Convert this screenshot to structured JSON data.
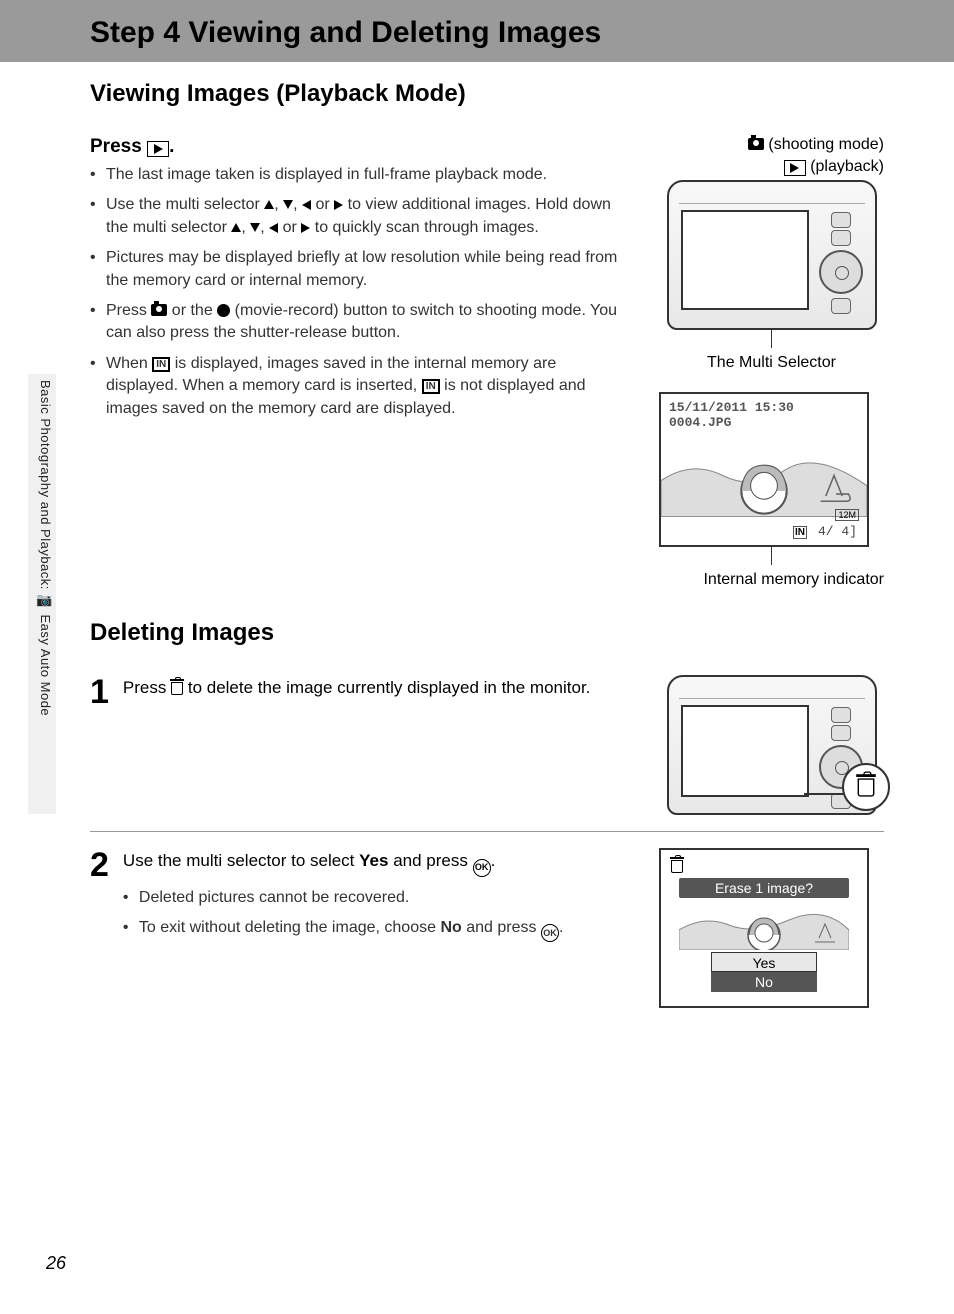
{
  "page_number": "26",
  "side_label": "Basic Photography and Playback: 📷 Easy Auto Mode",
  "title": "Step 4 Viewing and Deleting Images",
  "section_viewing": {
    "heading": "Viewing Images (Playback Mode)",
    "press_label": "Press",
    "bullets": {
      "b1": "The last image taken is displayed in full-frame playback mode.",
      "b2a": "Use the multi selector ",
      "b2b": " to view additional images. Hold down the multi selector ",
      "b2c": " to quickly scan through images.",
      "b3": "Pictures may be displayed briefly at low resolution while being read from the memory card or internal memory.",
      "b4a": "Press ",
      "b4b": " or the ",
      "b4c": " (movie-record) button to switch to shooting mode. You can also press the shutter-release button.",
      "b5a": "When ",
      "b5b": " is displayed, images saved in the internal memory are displayed. When a memory card is inserted, ",
      "b5c": " is not displayed and images saved on the memory card are displayed."
    },
    "labels": {
      "shooting": "(shooting mode)",
      "playback": "(playback)",
      "multi_selector": "The Multi Selector",
      "internal_mem": "Internal memory indicator"
    },
    "preview": {
      "date": "15/11/2011 15:30",
      "file": "0004.JPG",
      "count": "4/     4]",
      "res": "12M"
    }
  },
  "section_deleting": {
    "heading": "Deleting Images",
    "step1a": "Press ",
    "step1b": " to delete the image currently displayed in the monitor.",
    "step2a": "Use the multi selector to select ",
    "step2_yes": "Yes",
    "step2b": " and press ",
    "step2_bullets": {
      "s1": "Deleted pictures cannot be recovered.",
      "s2a": "To exit without deleting the image, choose ",
      "s2_no": "No",
      "s2b": " and press "
    },
    "erase_prompt": "Erase 1 image?",
    "opt_yes": "Yes",
    "opt_no": "No"
  }
}
